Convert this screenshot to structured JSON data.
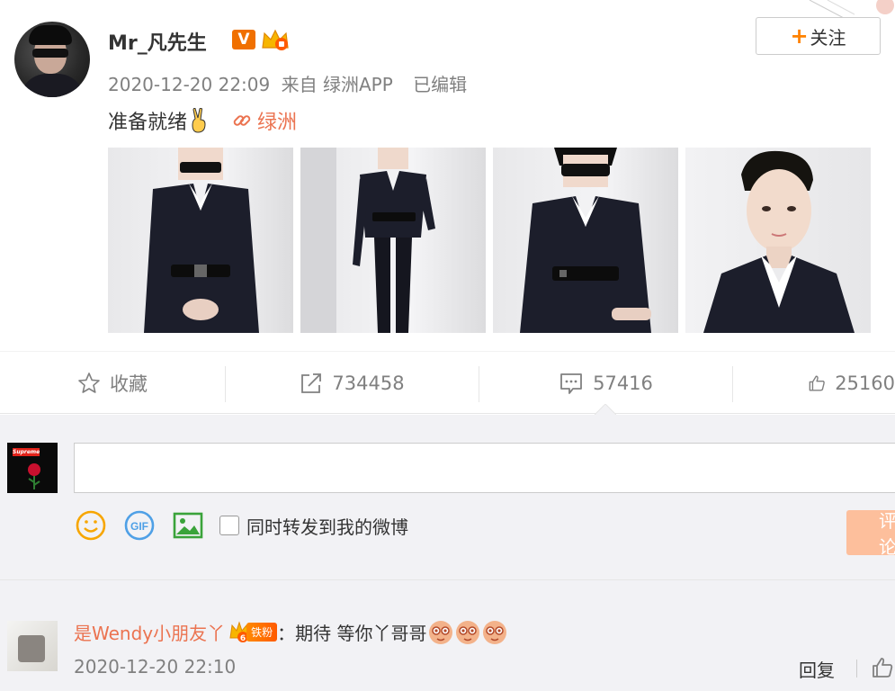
{
  "post": {
    "username": "Mr_凡先生",
    "verified_badge": "V",
    "follow_label": "关注",
    "time": "2020-12-20 22:09",
    "source": "来自 绿洲APP",
    "edited": "已编辑",
    "text": "准备就绪",
    "link_label": "绿洲",
    "photo_count": 4
  },
  "actions": {
    "favorite_label": "收藏",
    "repost_count": "734458",
    "comment_count": "57416",
    "like_count": "25160"
  },
  "composer": {
    "checkbox_label": "同时转发到我的微博",
    "submit_label": "评论",
    "sup_text": "Supreme"
  },
  "comment": {
    "username": "是Wendy小朋友丫",
    "fan_label": "铁粉",
    "fan_level": "6",
    "separator": "：",
    "text": "期待 等你丫哥哥",
    "time": "2020-12-20 22:10",
    "reply_label": "回复"
  },
  "colors": {
    "accent": "#eb7350",
    "follow_plus": "#ff8200",
    "verified": "#f07000",
    "submit_bg": "#fdbf9c",
    "composer_bg": "#f2f2f5"
  }
}
